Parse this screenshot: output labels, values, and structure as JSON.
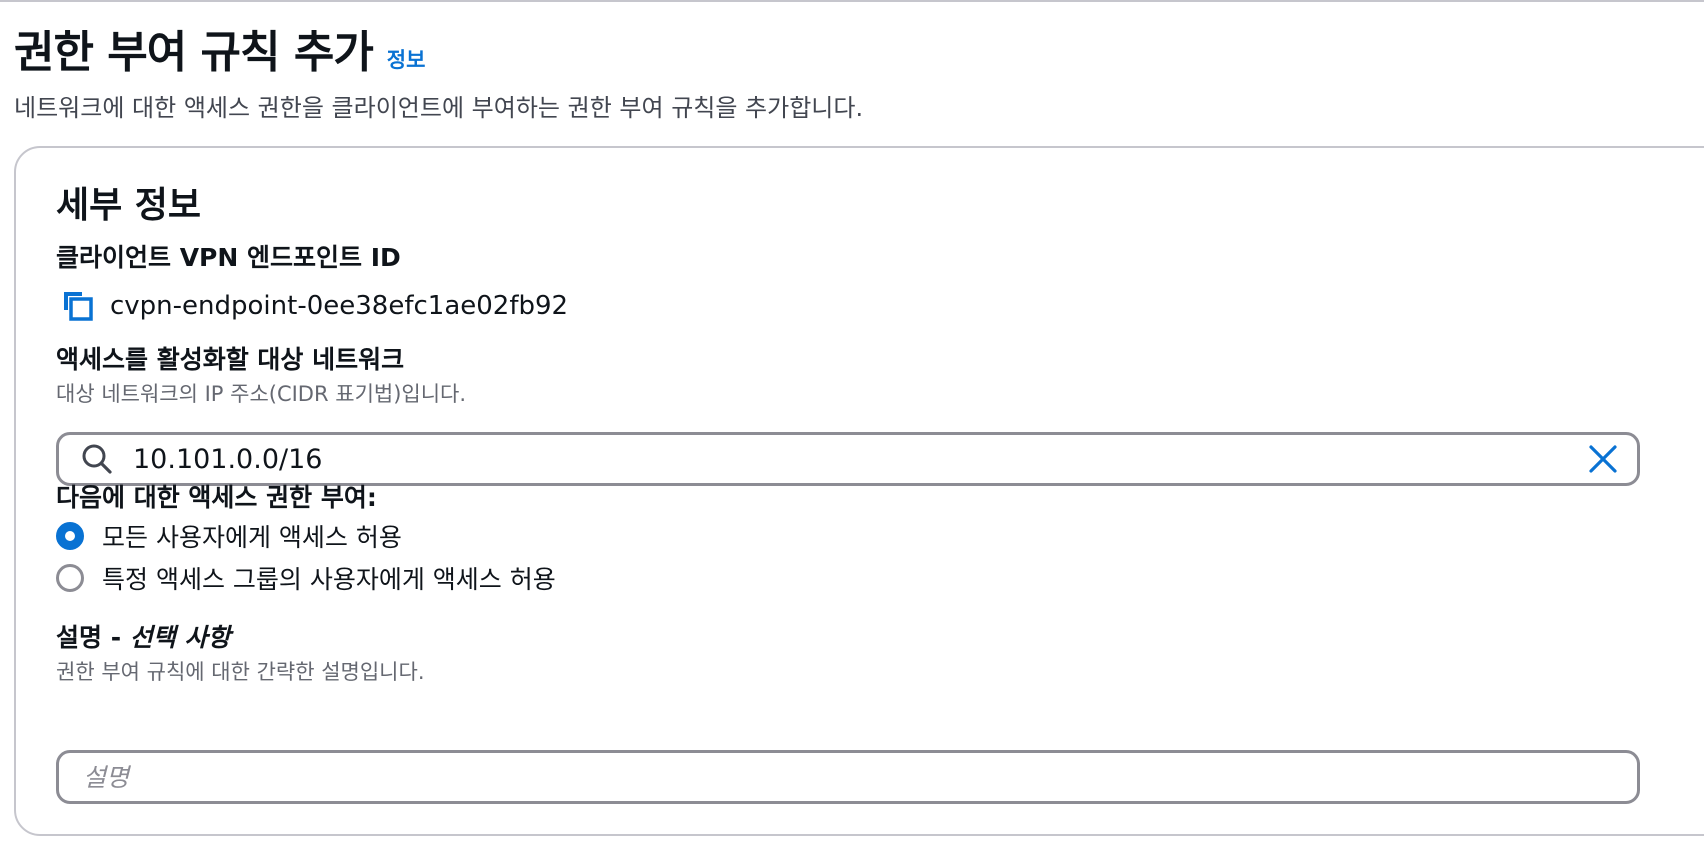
{
  "header": {
    "title": "권한 부여 규칙 추가",
    "info_link": "정보",
    "description": "네트워크에 대한 액세스 권한을 클라이언트에 부여하는 권한 부여 규칙을 추가합니다."
  },
  "details": {
    "section_title": "세부 정보",
    "endpoint": {
      "label": "클라이언트 VPN 엔드포인트 ID",
      "value": "cvpn-endpoint-0ee38efc1ae02fb92",
      "icon": "copy-icon"
    },
    "target_network": {
      "label": "액세스를 활성화할 대상 네트워크",
      "description": "대상 네트워크의 IP 주소(CIDR 표기법)입니다.",
      "value": "10.101.0.0/16",
      "left_icon": "search-icon",
      "right_icon": "clear-icon"
    },
    "grant_access": {
      "label": "다음에 대한 액세스 권한 부여:",
      "options": [
        {
          "label": "모든 사용자에게 액세스 허용",
          "checked": true
        },
        {
          "label": "특정 액세스 그룹의 사용자에게 액세스 허용",
          "checked": false
        }
      ]
    },
    "description_field": {
      "label_main": "설명 - ",
      "label_optional": "선택 사항",
      "description": "권한 부여 규칙에 대한 간략한 설명입니다.",
      "placeholder": "설명",
      "value": ""
    }
  },
  "colors": {
    "accent": "#0972d3",
    "border": "#8c8c94",
    "text": "#0f141a",
    "muted": "#656871"
  }
}
